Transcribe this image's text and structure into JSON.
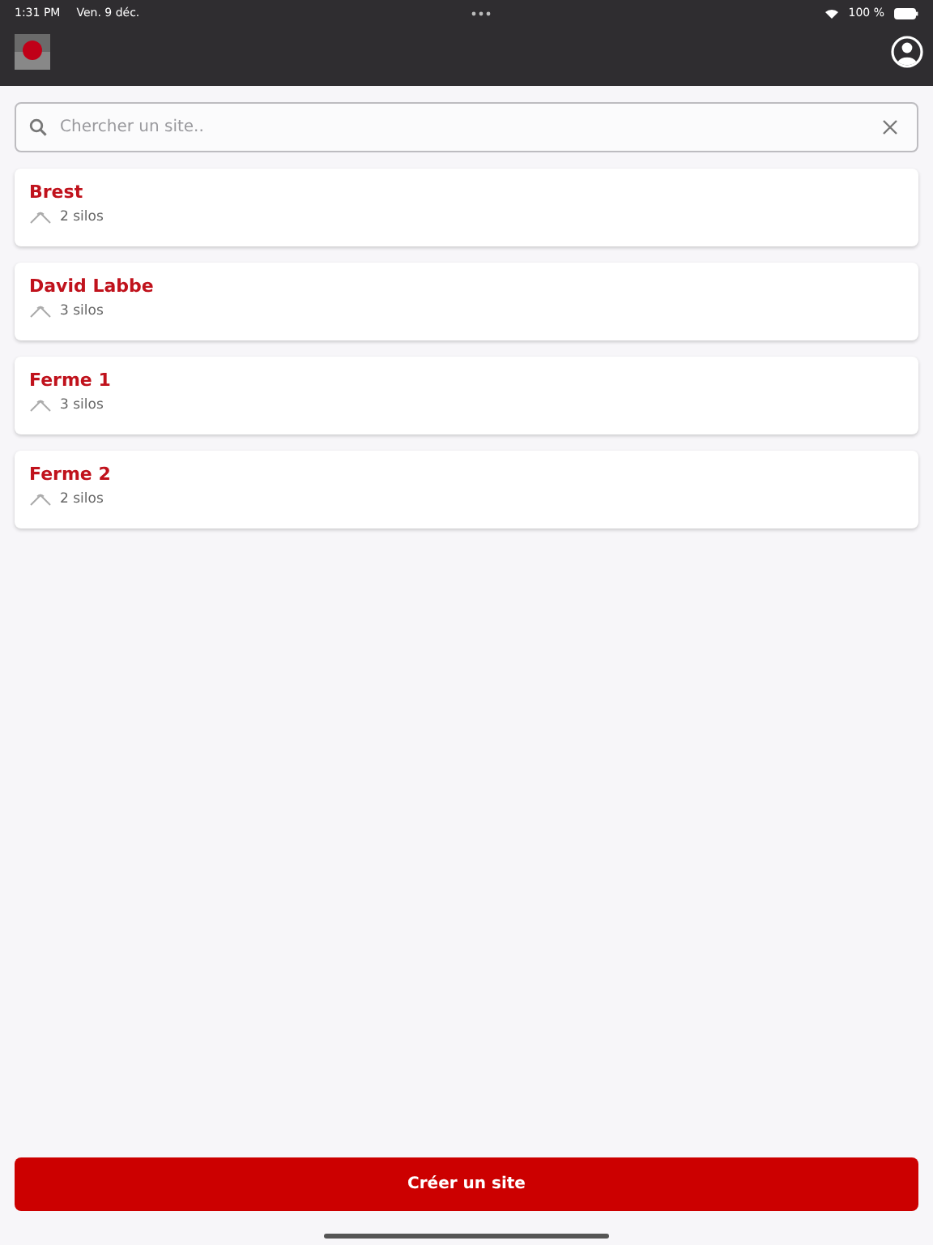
{
  "status_bar": {
    "time": "1:31 PM",
    "date": "Ven. 9 déc.",
    "battery": "100 %"
  },
  "search": {
    "placeholder": "Chercher un site.."
  },
  "sites": [
    {
      "name": "Brest",
      "silos": "2 silos"
    },
    {
      "name": "David Labbe",
      "silos": "3 silos"
    },
    {
      "name": "Ferme 1",
      "silos": "3 silos"
    },
    {
      "name": "Ferme 2",
      "silos": "2 silos"
    }
  ],
  "create_button": "Créer un site"
}
